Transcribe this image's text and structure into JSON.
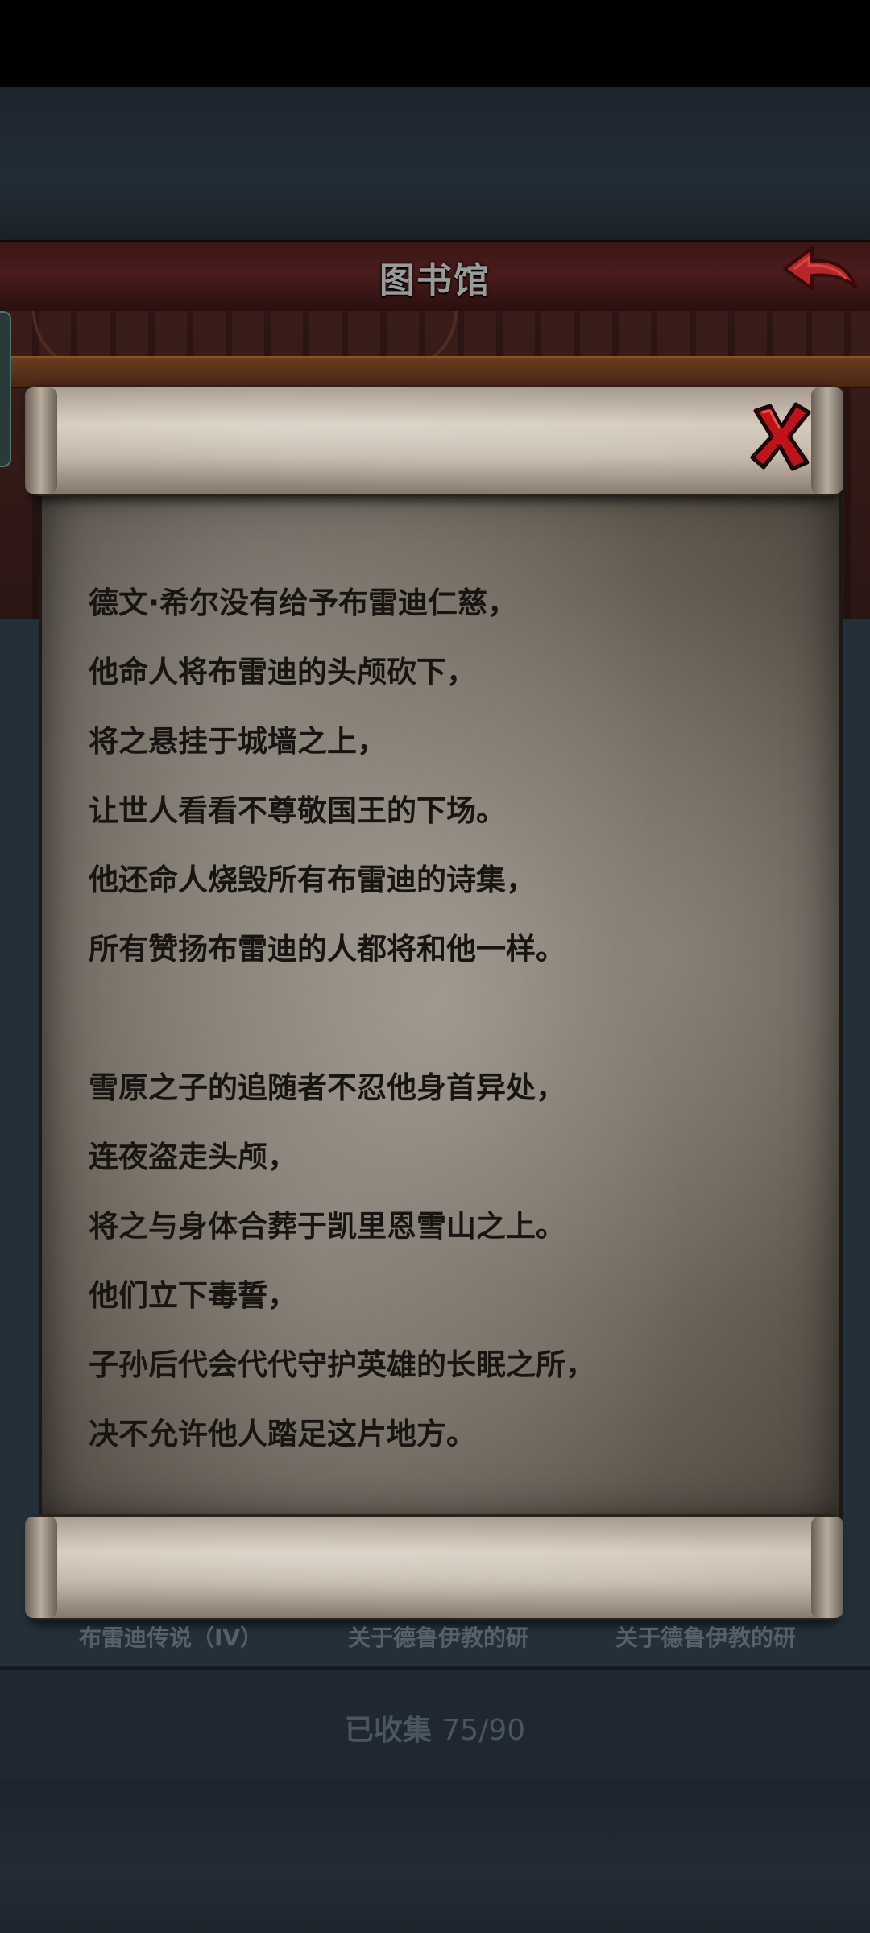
{
  "header": {
    "title": "图书馆"
  },
  "poem": {
    "lines": [
      "德文·希尔没有给予布雷迪仁慈，",
      "他命人将布雷迪的头颅砍下，",
      "将之悬挂于城墙之上，",
      "让世人看看不尊敬国王的下场。",
      "他还命人烧毁所有布雷迪的诗集，",
      "所有赞扬布雷迪的人都将和他一样。",
      "",
      "雪原之子的追随者不忍他身首异处，",
      "连夜盗走头颅，",
      "将之与身体合葬于凯里恩雪山之上。",
      "他们立下毒誓，",
      "子孙后代会代代守护英雄的长眠之所，",
      "决不允许他人踏足这片地方。"
    ]
  },
  "tabs": [
    "布雷迪传说（IV）",
    "关于德鲁伊教的研",
    "关于德鲁伊教的研"
  ],
  "footer": {
    "collected_label": "已收集",
    "collected_count": "75/90"
  },
  "colors": {
    "title_bar": "#4a1c1c",
    "back_arrow": "#b5272a",
    "close_x": "#c0121a",
    "parchment": "#7f776c"
  },
  "icons": {
    "back": "back-arrow-icon",
    "close": "close-x-icon"
  }
}
